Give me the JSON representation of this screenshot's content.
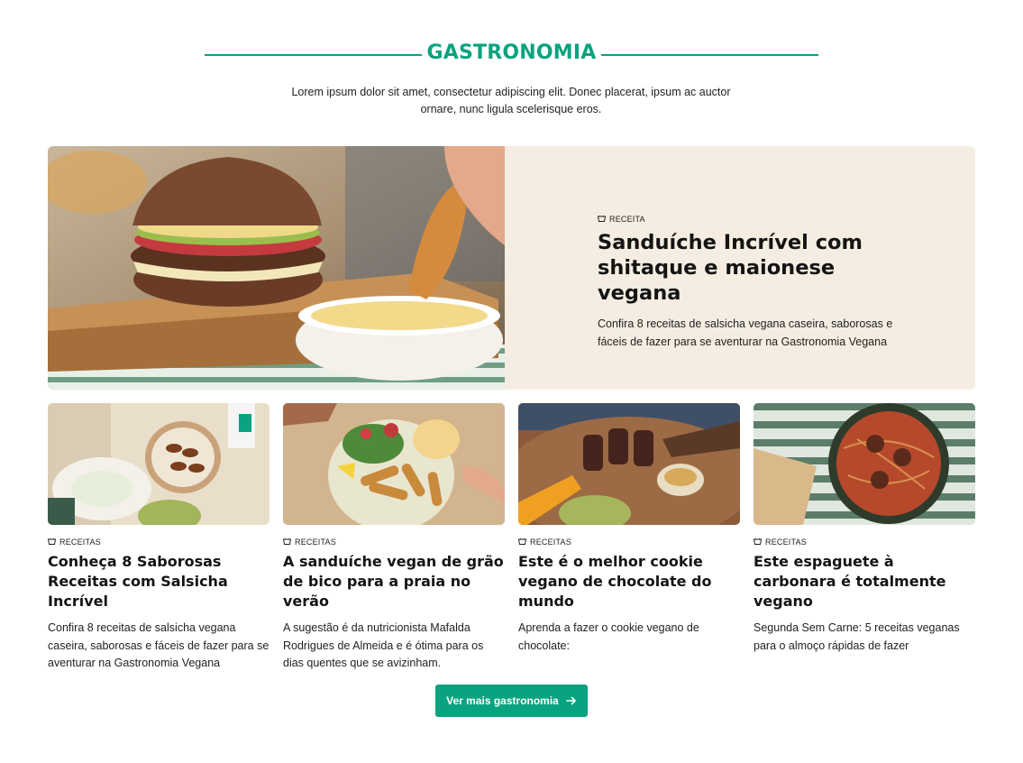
{
  "section": {
    "title": "GASTRONOMIA",
    "intro": "Lorem ipsum dolor sit amet, consectetur adipiscing elit. Donec placerat, ipsum ac auctor ornare, nunc ligula scelerisque eros."
  },
  "featured": {
    "tag": "RECEITA",
    "title": "Sanduíche Incrível com shitaque e maionese vegana",
    "description": "Confira 8 receitas de salsicha vegana caseira, saborosas e fáceis de fazer para se aventurar na Gastronomia Vegana",
    "icon": "bowl-icon"
  },
  "cards": [
    {
      "tag": "RECEITAS",
      "title": "Conheça 8 Saborosas Receitas com Salsicha Incrível",
      "description": "Confira 8 receitas de salsicha vegana caseira, saborosas e fáceis de fazer para se aventurar na Gastronomia Vegana"
    },
    {
      "tag": "RECEITAS",
      "title": "A sanduíche vegan de grão de bico para a praia no verão",
      "description": "A sugestão é da nutricionista Mafalda Rodrigues de Almeida e é ótima para os dias quentes que se avizinham."
    },
    {
      "tag": "RECEITAS",
      "title": "Este é o melhor cookie vegano de chocolate do mundo",
      "description": "Aprenda a fazer o cookie vegano de chocolate:"
    },
    {
      "tag": "RECEITAS",
      "title": "Este espaguete à carbonara é totalmente vegano",
      "description": "Segunda Sem Carne: 5 receitas veganas para o almoço rápidas de fazer"
    }
  ],
  "more_button": {
    "label": "Ver mais gastronomia",
    "icon": "arrow-right-icon"
  },
  "colors": {
    "accent": "#0aa37f",
    "featured_bg": "#f5ede1"
  }
}
